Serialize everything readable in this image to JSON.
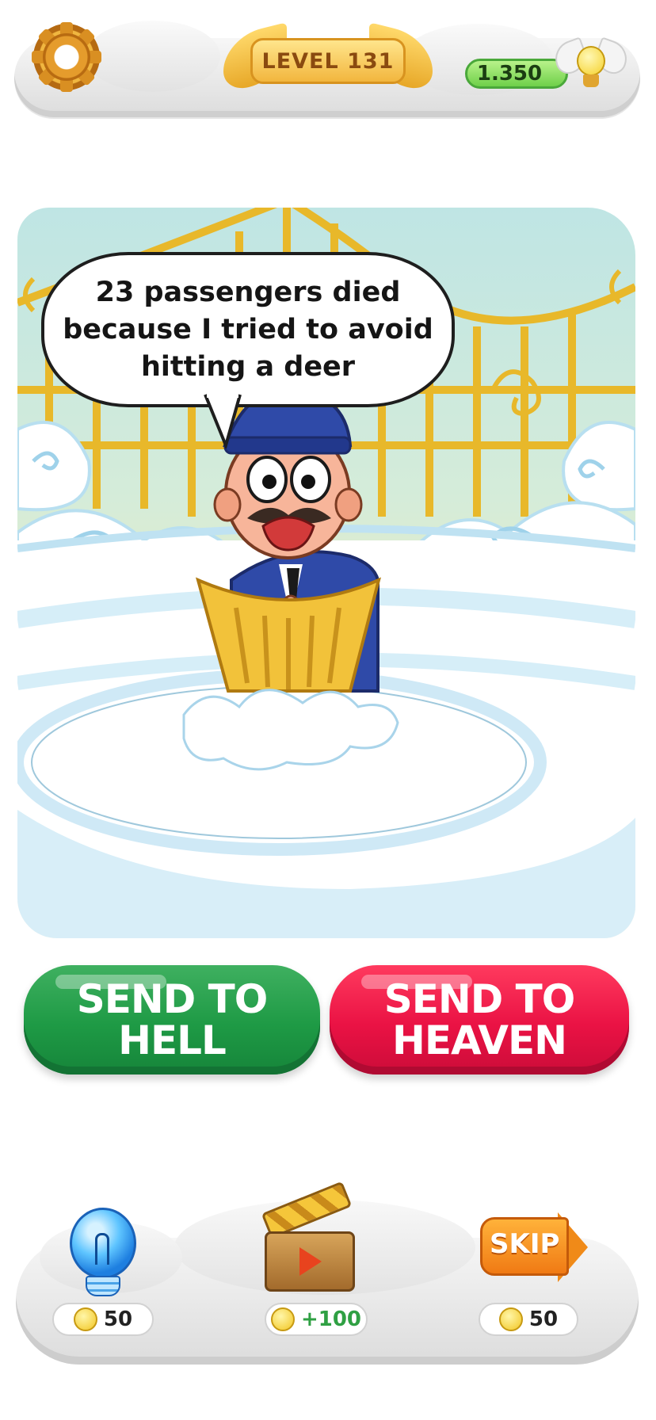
{
  "header": {
    "settings_icon": "gear-icon",
    "level_label": "LEVEL 131",
    "coins": "1.350",
    "coin_icon": "winged-bulb-icon"
  },
  "dialog": {
    "speech": "23  passengers died because I tried to avoid hitting a deer"
  },
  "actions": {
    "send_to_hell": "SEND TO HELL",
    "send_to_heaven": "SEND TO HEAVEN"
  },
  "tools": {
    "hint": {
      "icon": "lightbulb-icon",
      "cost": "50"
    },
    "video": {
      "icon": "clapperboard-icon",
      "reward": "+100"
    },
    "skip": {
      "label": "SKIP",
      "cost": "50"
    }
  },
  "colors": {
    "hell_button": "#1e9a45",
    "heaven_button": "#ea1244",
    "coin_pill": "#6fd04a",
    "level_badge": "#f2b63e"
  }
}
